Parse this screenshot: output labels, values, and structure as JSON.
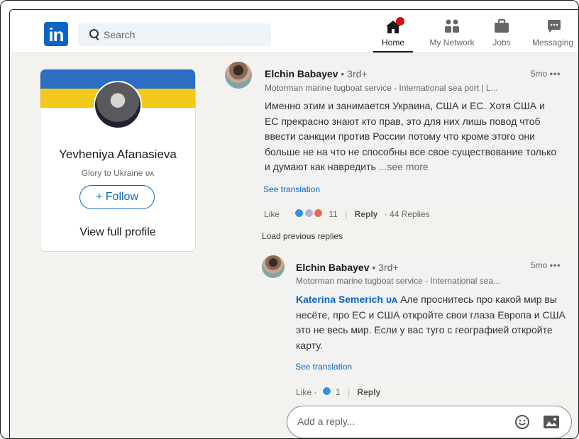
{
  "header": {
    "logo": "in",
    "search_placeholder": "Search",
    "nav": [
      {
        "label": "Home",
        "icon": "home-icon",
        "active": true
      },
      {
        "label": "My Network",
        "icon": "network-icon"
      },
      {
        "label": "Jobs",
        "icon": "briefcase-icon"
      },
      {
        "label": "Messaging",
        "icon": "messaging-icon"
      }
    ]
  },
  "profile": {
    "name": "Yevheniya Afanasieva",
    "tagline": "Glory to Ukraine ᴜᴀ",
    "follow_label": "+ Follow",
    "view_profile_label": "View full profile"
  },
  "comment": {
    "author": "Elchin Babayev",
    "degree": "• 3rd+",
    "subtitle": "Motorman marine tugboat service - International sea port | L...",
    "time": "5mo",
    "text": "Именно этим и занимается Украина, США и ЕС. Хотя США и ЕС прекрасно знают кто прав, это для них лишь повод чтоб ввести санкции против России потому что кроме этого они больше не на что не способны все свое существование только и думают как навредить",
    "see_more": "...see more",
    "see_translation": "See translation",
    "like_label": "Like",
    "reaction_count": "11",
    "reply_label": "Reply",
    "replies_count": "· 44 Replies"
  },
  "load_previous": "Load previous replies",
  "reply": {
    "author": "Elchin Babayev",
    "degree": "• 3rd+",
    "subtitle": "Motorman marine tugboat service - International sea...",
    "time": "5mo",
    "mention": "Katerina Semerich ᴜᴀ",
    "text": " Але проснитесь про какой мир вы несёте, про ЕС и США откройте свои глаза Европа и США это не весь мир. Если у вас туго с географией откройте карту.",
    "see_translation": "See translation",
    "like_label": "Like ·",
    "reaction_count": "1",
    "reply_label": "Reply"
  },
  "reply_box": {
    "placeholder": "Add a reply..."
  },
  "colors": {
    "brand": "#0a66c2",
    "flag_blue": "#2d6ec5",
    "flag_yellow": "#f4c91a",
    "notification": "#cc1016"
  }
}
